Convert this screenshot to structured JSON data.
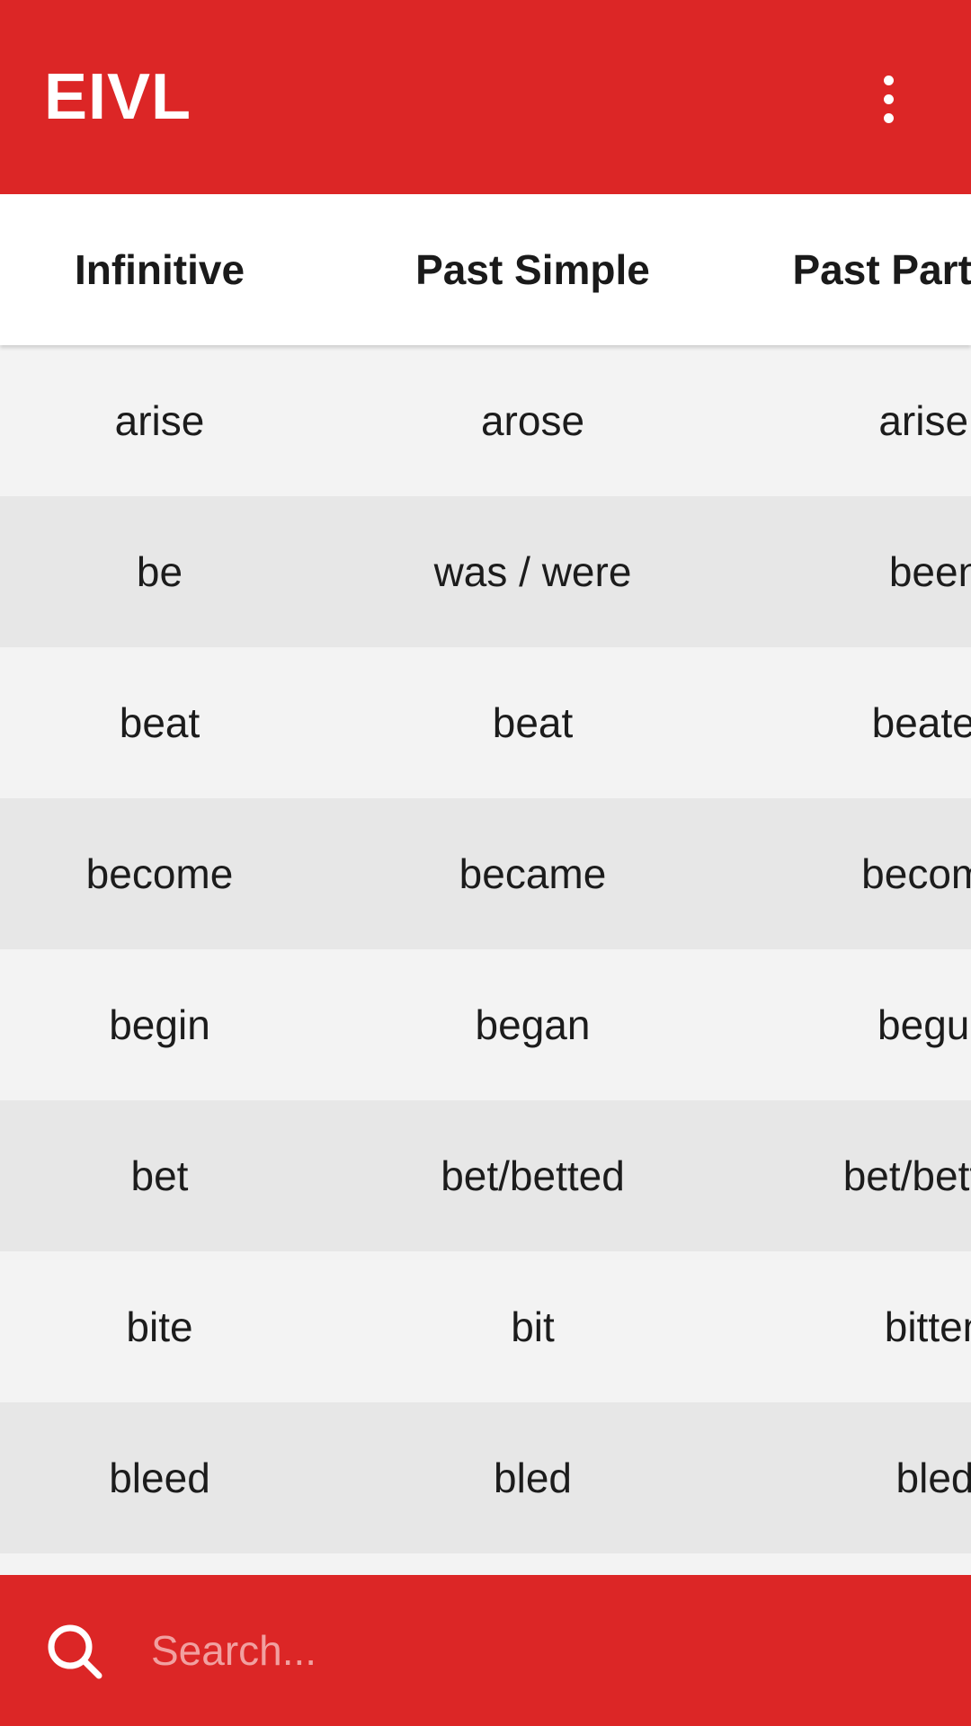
{
  "app_bar": {
    "title": "EIVL",
    "overflow_icon": "more-vert-icon",
    "color": "#dc2626"
  },
  "table": {
    "columns": [
      "Infinitive",
      "Past Simple",
      "Past Participle"
    ],
    "rows": [
      [
        "arise",
        "arose",
        "arisen"
      ],
      [
        "be",
        "was / were",
        "been"
      ],
      [
        "beat",
        "beat",
        "beaten"
      ],
      [
        "become",
        "became",
        "become"
      ],
      [
        "begin",
        "began",
        "begun"
      ],
      [
        "bet",
        "bet/betted",
        "bet/betted"
      ],
      [
        "bite",
        "bit",
        "bitten"
      ],
      [
        "bleed",
        "bled",
        "bled"
      ]
    ],
    "row_colors": [
      "#f3f3f3",
      "#e7e7e7"
    ]
  },
  "search": {
    "placeholder": "Search...",
    "value": "",
    "icon": "search-icon"
  }
}
